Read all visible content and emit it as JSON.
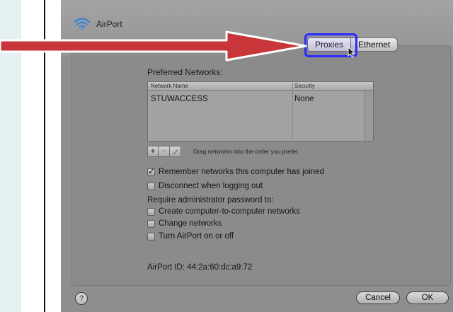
{
  "window": {
    "title": "AirPort"
  },
  "tabs": [
    {
      "label": "Proxies",
      "selected": true
    },
    {
      "label": "Ethernet",
      "selected": false
    }
  ],
  "preferred_networks": {
    "label": "Preferred Networks:",
    "columns": [
      "Network Name",
      "Security"
    ],
    "rows": [
      {
        "name": "STUWACCESS",
        "security": "None"
      }
    ],
    "add_label": "+",
    "remove_label": "−",
    "drag_hint": "Drag networks into the order you prefer."
  },
  "options": {
    "remember": {
      "label": "Remember networks this computer has joined",
      "checked": true
    },
    "disconnect": {
      "label": "Disconnect when logging out",
      "checked": false
    },
    "require_label": "Require administrator password to:",
    "create": {
      "label": "Create computer-to-computer networks",
      "checked": false
    },
    "change": {
      "label": "Change networks",
      "checked": false
    },
    "turn": {
      "label": "Turn AirPort on or off",
      "checked": false
    }
  },
  "airport_id": "AirPort ID:   44:2a:60:dc:a9:72",
  "footer": {
    "help_label": "?",
    "cancel_label": "Cancel",
    "ok_label": "OK"
  },
  "colors": {
    "arrow": "#c9363a",
    "highlight": "#2b2bff",
    "wifi": "#3a86d4"
  },
  "icons": [
    "wifi-icon",
    "pencil-icon",
    "arrow-pointer-icon",
    "annotation-arrow"
  ]
}
